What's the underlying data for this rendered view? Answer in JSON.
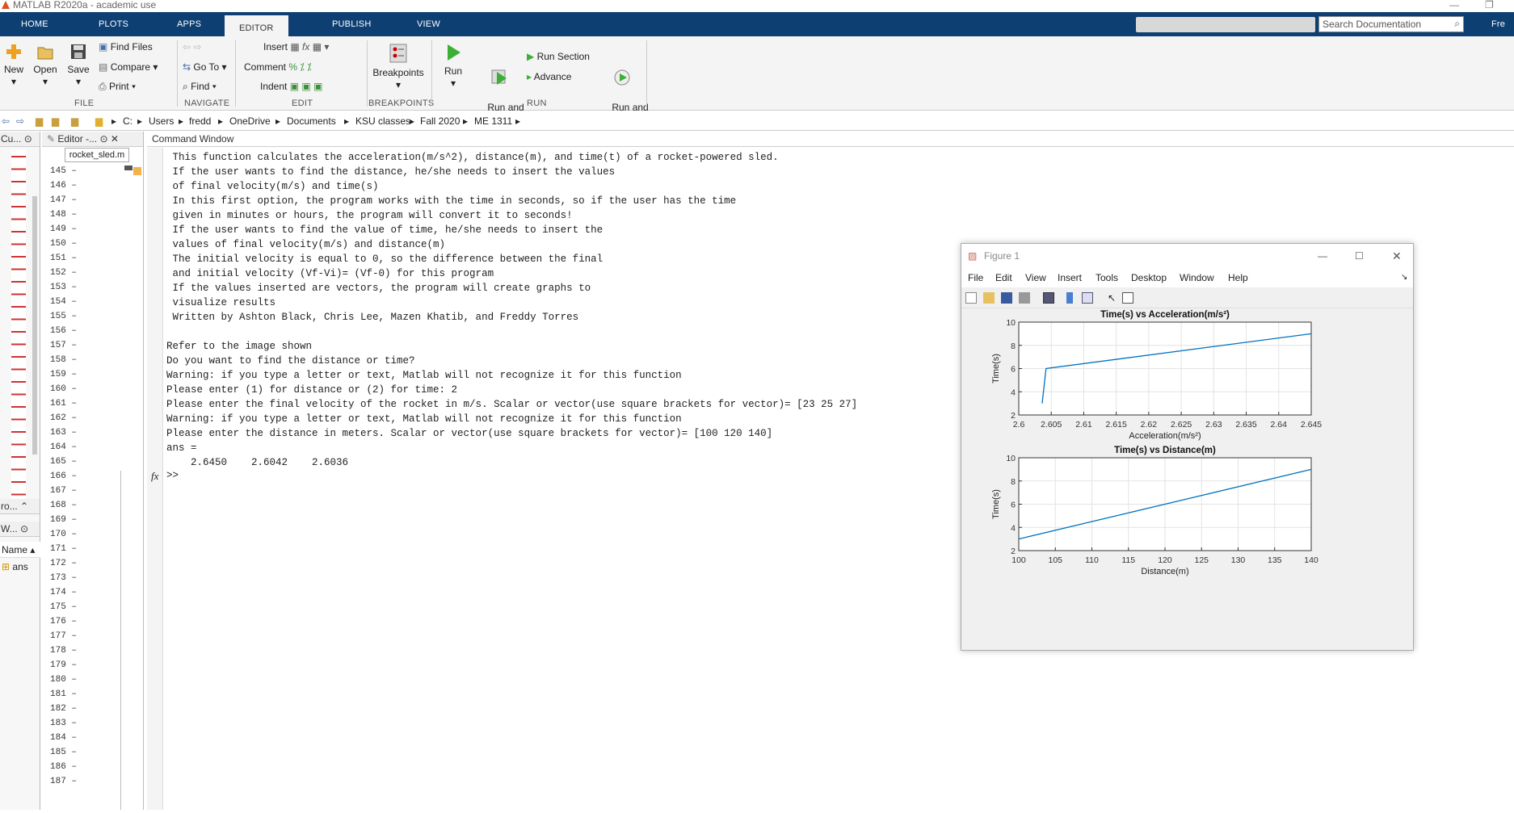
{
  "window": {
    "title": "MATLAB R2020a - academic use"
  },
  "tabs": [
    "HOME",
    "PLOTS",
    "APPS",
    "EDITOR",
    "PUBLISH",
    "VIEW"
  ],
  "active_tab": "EDITOR",
  "search": {
    "placeholder": "Search Documentation"
  },
  "user_label": "Fre",
  "ribbon": {
    "file": {
      "new": "New",
      "open": "Open",
      "save": "Save",
      "find_files": "Find Files",
      "compare": "Compare",
      "print": "Print",
      "section": "FILE"
    },
    "navigate": {
      "go_to": "Go To",
      "find": "Find",
      "section": "NAVIGATE"
    },
    "edit": {
      "insert": "Insert",
      "comment": "Comment",
      "indent": "Indent",
      "section": "EDIT"
    },
    "breakpoints": {
      "label": "Breakpoints",
      "section": "BREAKPOINTS"
    },
    "run": {
      "run": "Run",
      "run_and_advance": "Run and\nAdvance",
      "run_section": "Run Section",
      "advance": "Advance",
      "run_and_time": "Run and\nTime",
      "section": "RUN"
    }
  },
  "address": [
    "C:",
    "Users",
    "fredd",
    "OneDrive",
    "Documents",
    "KSU classes",
    "Fall 2020",
    "ME 1311"
  ],
  "left_panel": {
    "current_folder": "Cu...",
    "bottom_label": "ro...",
    "workspace": "W...",
    "name_col": "Name",
    "var": "ans"
  },
  "editor": {
    "title": "Editor -...",
    "file_tab": "rocket_sled.m",
    "lines": [
      "145",
      "146",
      "147",
      "148",
      "149",
      "150",
      "151",
      "152",
      "153",
      "154",
      "155",
      "156",
      "157",
      "158",
      "159",
      "160",
      "161",
      "162",
      "163",
      "164",
      "165",
      "166",
      "167",
      "168",
      "169",
      "170",
      "171",
      "172",
      "173",
      "174",
      "175",
      "176",
      "177",
      "178",
      "179",
      "180",
      "181",
      "182",
      "183",
      "184",
      "185",
      "186",
      "187"
    ]
  },
  "command_window": {
    "title": "Command Window",
    "lines": [
      " This function calculates the acceleration(m/s^2), distance(m), and time(t) of a rocket-powered sled.",
      " If the user wants to find the distance, he/she needs to insert the values",
      " of final velocity(m/s) and time(s)",
      " In this first option, the program works with the time in seconds, so if the user has the time",
      " given in minutes or hours, the program will convert it to seconds!",
      " If the user wants to find the value of time, he/she needs to insert the",
      " values of final velocity(m/s) and distance(m)",
      " The initial velocity is equal to 0, so the difference between the final",
      " and initial velocity (Vf-Vi)= (Vf-0) for this program",
      " If the values inserted are vectors, the program will create graphs to",
      " visualize results",
      " Written by Ashton Black, Chris Lee, Mazen Khatib, and Freddy Torres",
      "",
      "Refer to the image shown",
      "Do you want to find the distance or time?",
      "Warning: if you type a letter or text, Matlab will not recognize it for this function",
      "Please enter (1) for distance or (2) for time: 2",
      "Please enter the final velocity of the rocket in m/s. Scalar or vector(use square brackets for vector)= [23 25 27]",
      "Warning: if you type a letter or text, Matlab will not recognize it for this function",
      "Please enter the distance in meters. Scalar or vector(use square brackets for vector)= [100 120 140]",
      "ans =",
      "    2.6450    2.6042    2.6036"
    ],
    "prompt": ">>",
    "fx": "fx"
  },
  "figure": {
    "title": "Figure 1",
    "menu": [
      "File",
      "Edit",
      "View",
      "Insert",
      "Tools",
      "Desktop",
      "Window",
      "Help"
    ]
  },
  "chart_data": [
    {
      "type": "line",
      "title": "Time(s) vs Acceleration(m/s²)",
      "xlabel": "Acceleration(m/s²)",
      "ylabel": "Time(s)",
      "xlim": [
        2.6,
        2.645
      ],
      "ylim": [
        2,
        10
      ],
      "xticks": [
        "2.6",
        "2.605",
        "2.61",
        "2.615",
        "2.62",
        "2.625",
        "2.63",
        "2.635",
        "2.64",
        "2.645"
      ],
      "yticks": [
        "2",
        "4",
        "6",
        "8",
        "10"
      ],
      "grid": true,
      "color": "#0072bd",
      "x": [
        2.6036,
        2.6042,
        2.645
      ],
      "y": [
        3,
        6,
        9
      ]
    },
    {
      "type": "line",
      "title": "Time(s) vs Distance(m)",
      "xlabel": "Distance(m)",
      "ylabel": "Time(s)",
      "xlim": [
        100,
        140
      ],
      "ylim": [
        2,
        10
      ],
      "xticks": [
        "100",
        "105",
        "110",
        "115",
        "120",
        "125",
        "130",
        "135",
        "140"
      ],
      "yticks": [
        "2",
        "4",
        "6",
        "8",
        "10"
      ],
      "grid": true,
      "color": "#0072bd",
      "x": [
        100,
        120,
        140
      ],
      "y": [
        3,
        6,
        9
      ]
    }
  ]
}
